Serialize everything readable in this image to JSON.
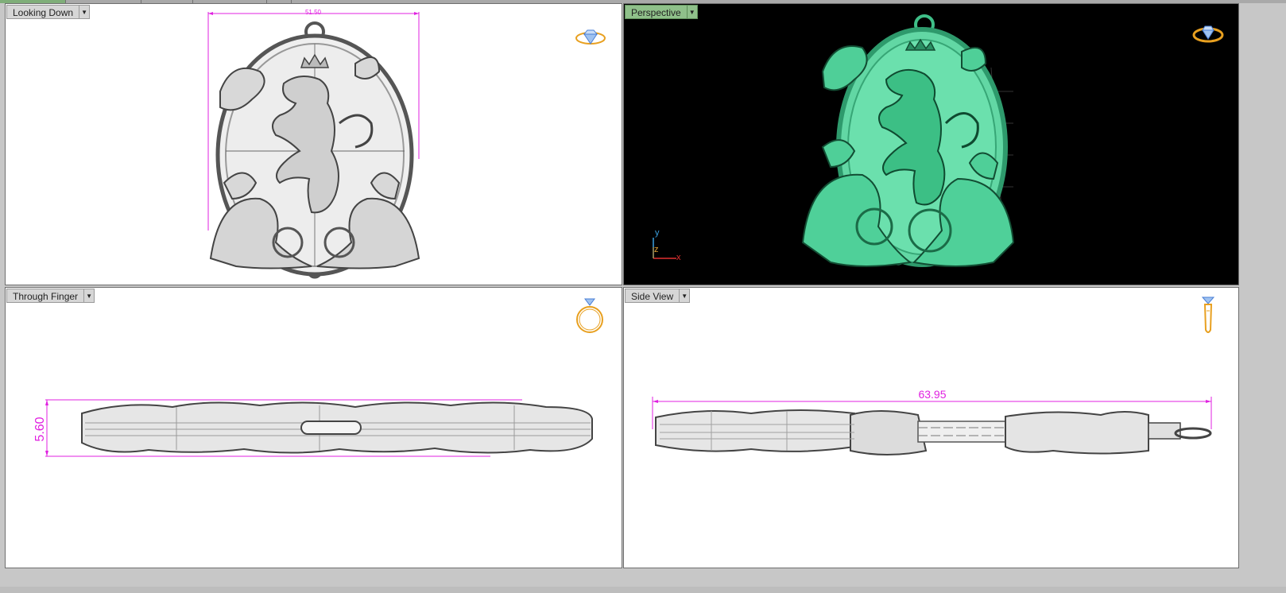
{
  "viewports": {
    "top_left": {
      "label": "Looking Down",
      "dimension": "51.50",
      "active": false
    },
    "top_right": {
      "label": "Perspective",
      "active": true,
      "axis": {
        "y": "y",
        "z": "z",
        "x": "x"
      }
    },
    "bottom_left": {
      "label": "Through Finger",
      "dimension": "5.60",
      "active": false
    },
    "bottom_right": {
      "label": "Side View",
      "dimension": "63.95",
      "active": false
    }
  },
  "icons": {
    "dropdown": "chevron-down-icon",
    "nav_top": "ring-top-nav-icon",
    "nav_persp": "ring-perspective-nav-icon",
    "nav_front": "ring-front-nav-icon",
    "nav_side": "ring-side-nav-icon"
  },
  "colors": {
    "dimension": "#e021e0",
    "active_label": "#8fc08a",
    "model_shaded": "#5fd6a3",
    "nav_gold": "#e8a020",
    "nav_blue": "#4a7fd6",
    "axis_x": "#e03030",
    "axis_y": "#3aa0e0",
    "axis_z": "#e0a030"
  }
}
